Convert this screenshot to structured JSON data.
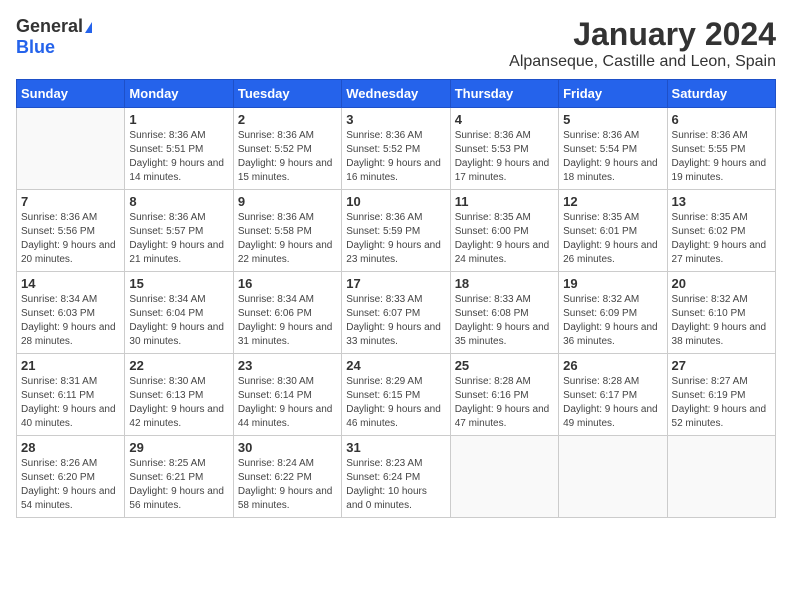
{
  "header": {
    "logo_general": "General",
    "logo_blue": "Blue",
    "title": "January 2024",
    "location": "Alpanseque, Castille and Leon, Spain"
  },
  "weekdays": [
    "Sunday",
    "Monday",
    "Tuesday",
    "Wednesday",
    "Thursday",
    "Friday",
    "Saturday"
  ],
  "weeks": [
    [
      {
        "day": "",
        "sunrise": "",
        "sunset": "",
        "daylight": ""
      },
      {
        "day": "1",
        "sunrise": "Sunrise: 8:36 AM",
        "sunset": "Sunset: 5:51 PM",
        "daylight": "Daylight: 9 hours and 14 minutes."
      },
      {
        "day": "2",
        "sunrise": "Sunrise: 8:36 AM",
        "sunset": "Sunset: 5:52 PM",
        "daylight": "Daylight: 9 hours and 15 minutes."
      },
      {
        "day": "3",
        "sunrise": "Sunrise: 8:36 AM",
        "sunset": "Sunset: 5:52 PM",
        "daylight": "Daylight: 9 hours and 16 minutes."
      },
      {
        "day": "4",
        "sunrise": "Sunrise: 8:36 AM",
        "sunset": "Sunset: 5:53 PM",
        "daylight": "Daylight: 9 hours and 17 minutes."
      },
      {
        "day": "5",
        "sunrise": "Sunrise: 8:36 AM",
        "sunset": "Sunset: 5:54 PM",
        "daylight": "Daylight: 9 hours and 18 minutes."
      },
      {
        "day": "6",
        "sunrise": "Sunrise: 8:36 AM",
        "sunset": "Sunset: 5:55 PM",
        "daylight": "Daylight: 9 hours and 19 minutes."
      }
    ],
    [
      {
        "day": "7",
        "sunrise": "Sunrise: 8:36 AM",
        "sunset": "Sunset: 5:56 PM",
        "daylight": "Daylight: 9 hours and 20 minutes."
      },
      {
        "day": "8",
        "sunrise": "Sunrise: 8:36 AM",
        "sunset": "Sunset: 5:57 PM",
        "daylight": "Daylight: 9 hours and 21 minutes."
      },
      {
        "day": "9",
        "sunrise": "Sunrise: 8:36 AM",
        "sunset": "Sunset: 5:58 PM",
        "daylight": "Daylight: 9 hours and 22 minutes."
      },
      {
        "day": "10",
        "sunrise": "Sunrise: 8:36 AM",
        "sunset": "Sunset: 5:59 PM",
        "daylight": "Daylight: 9 hours and 23 minutes."
      },
      {
        "day": "11",
        "sunrise": "Sunrise: 8:35 AM",
        "sunset": "Sunset: 6:00 PM",
        "daylight": "Daylight: 9 hours and 24 minutes."
      },
      {
        "day": "12",
        "sunrise": "Sunrise: 8:35 AM",
        "sunset": "Sunset: 6:01 PM",
        "daylight": "Daylight: 9 hours and 26 minutes."
      },
      {
        "day": "13",
        "sunrise": "Sunrise: 8:35 AM",
        "sunset": "Sunset: 6:02 PM",
        "daylight": "Daylight: 9 hours and 27 minutes."
      }
    ],
    [
      {
        "day": "14",
        "sunrise": "Sunrise: 8:34 AM",
        "sunset": "Sunset: 6:03 PM",
        "daylight": "Daylight: 9 hours and 28 minutes."
      },
      {
        "day": "15",
        "sunrise": "Sunrise: 8:34 AM",
        "sunset": "Sunset: 6:04 PM",
        "daylight": "Daylight: 9 hours and 30 minutes."
      },
      {
        "day": "16",
        "sunrise": "Sunrise: 8:34 AM",
        "sunset": "Sunset: 6:06 PM",
        "daylight": "Daylight: 9 hours and 31 minutes."
      },
      {
        "day": "17",
        "sunrise": "Sunrise: 8:33 AM",
        "sunset": "Sunset: 6:07 PM",
        "daylight": "Daylight: 9 hours and 33 minutes."
      },
      {
        "day": "18",
        "sunrise": "Sunrise: 8:33 AM",
        "sunset": "Sunset: 6:08 PM",
        "daylight": "Daylight: 9 hours and 35 minutes."
      },
      {
        "day": "19",
        "sunrise": "Sunrise: 8:32 AM",
        "sunset": "Sunset: 6:09 PM",
        "daylight": "Daylight: 9 hours and 36 minutes."
      },
      {
        "day": "20",
        "sunrise": "Sunrise: 8:32 AM",
        "sunset": "Sunset: 6:10 PM",
        "daylight": "Daylight: 9 hours and 38 minutes."
      }
    ],
    [
      {
        "day": "21",
        "sunrise": "Sunrise: 8:31 AM",
        "sunset": "Sunset: 6:11 PM",
        "daylight": "Daylight: 9 hours and 40 minutes."
      },
      {
        "day": "22",
        "sunrise": "Sunrise: 8:30 AM",
        "sunset": "Sunset: 6:13 PM",
        "daylight": "Daylight: 9 hours and 42 minutes."
      },
      {
        "day": "23",
        "sunrise": "Sunrise: 8:30 AM",
        "sunset": "Sunset: 6:14 PM",
        "daylight": "Daylight: 9 hours and 44 minutes."
      },
      {
        "day": "24",
        "sunrise": "Sunrise: 8:29 AM",
        "sunset": "Sunset: 6:15 PM",
        "daylight": "Daylight: 9 hours and 46 minutes."
      },
      {
        "day": "25",
        "sunrise": "Sunrise: 8:28 AM",
        "sunset": "Sunset: 6:16 PM",
        "daylight": "Daylight: 9 hours and 47 minutes."
      },
      {
        "day": "26",
        "sunrise": "Sunrise: 8:28 AM",
        "sunset": "Sunset: 6:17 PM",
        "daylight": "Daylight: 9 hours and 49 minutes."
      },
      {
        "day": "27",
        "sunrise": "Sunrise: 8:27 AM",
        "sunset": "Sunset: 6:19 PM",
        "daylight": "Daylight: 9 hours and 52 minutes."
      }
    ],
    [
      {
        "day": "28",
        "sunrise": "Sunrise: 8:26 AM",
        "sunset": "Sunset: 6:20 PM",
        "daylight": "Daylight: 9 hours and 54 minutes."
      },
      {
        "day": "29",
        "sunrise": "Sunrise: 8:25 AM",
        "sunset": "Sunset: 6:21 PM",
        "daylight": "Daylight: 9 hours and 56 minutes."
      },
      {
        "day": "30",
        "sunrise": "Sunrise: 8:24 AM",
        "sunset": "Sunset: 6:22 PM",
        "daylight": "Daylight: 9 hours and 58 minutes."
      },
      {
        "day": "31",
        "sunrise": "Sunrise: 8:23 AM",
        "sunset": "Sunset: 6:24 PM",
        "daylight": "Daylight: 10 hours and 0 minutes."
      },
      {
        "day": "",
        "sunrise": "",
        "sunset": "",
        "daylight": ""
      },
      {
        "day": "",
        "sunrise": "",
        "sunset": "",
        "daylight": ""
      },
      {
        "day": "",
        "sunrise": "",
        "sunset": "",
        "daylight": ""
      }
    ]
  ]
}
